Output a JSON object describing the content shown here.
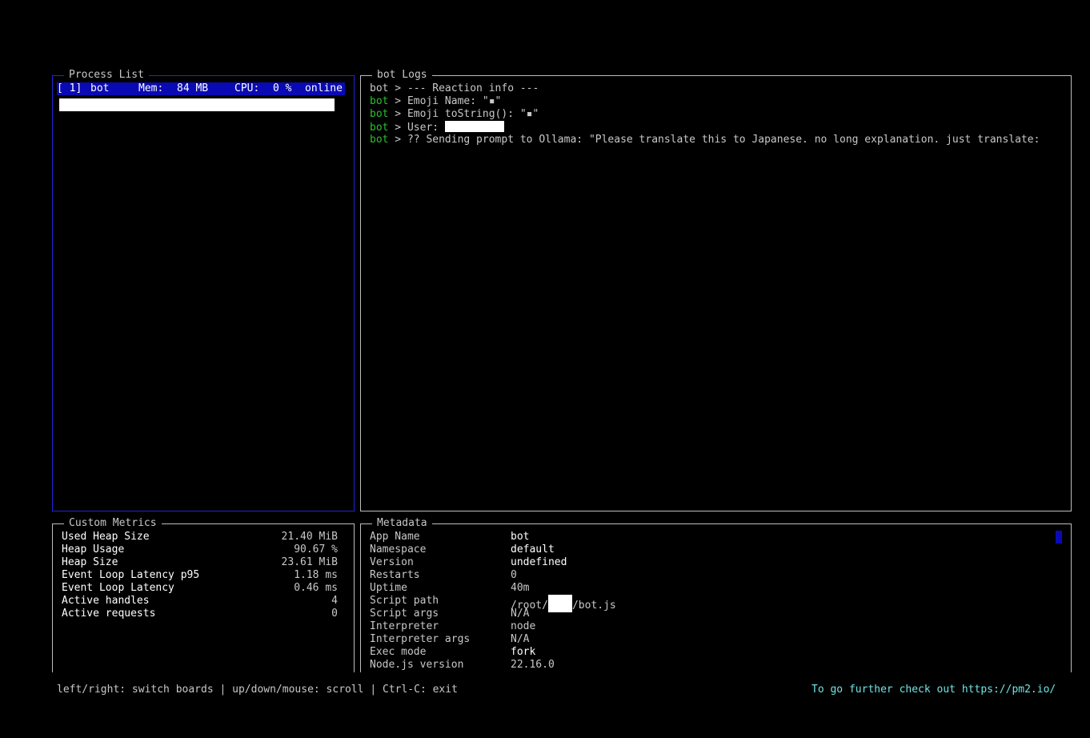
{
  "process_list": {
    "title": "Process List",
    "row": {
      "id": "[ 1]",
      "name": "bot",
      "mem_label": "Mem:",
      "mem_value": "84 MB",
      "cpu_label": "CPU:",
      "cpu_value": "0 %",
      "status": "online"
    }
  },
  "logs": {
    "title": "bot Logs",
    "lines": [
      {
        "source": "bot",
        "text": " > --- Reaction info ---"
      },
      {
        "source": "bot",
        "text": " > Emoji Name: \"▪\""
      },
      {
        "source": "bot",
        "text": " > Emoji toString(): \"▪\""
      },
      {
        "source": "bot",
        "text": " > User: "
      },
      {
        "source": "bot",
        "text": " > ?? Sending prompt to Ollama: \"Please translate this to Japanese. no long explanation. just translate:"
      }
    ]
  },
  "metrics": {
    "title": "Custom Metrics",
    "rows": [
      {
        "name": "Used Heap Size",
        "value": "21.40 MiB"
      },
      {
        "name": "Heap Usage",
        "value": "90.67 %"
      },
      {
        "name": "Heap Size",
        "value": "23.61 MiB"
      },
      {
        "name": "Event Loop Latency p95",
        "value": "1.18 ms"
      },
      {
        "name": "Event Loop Latency",
        "value": "0.46 ms"
      },
      {
        "name": "Active handles",
        "value": "4"
      },
      {
        "name": "Active requests",
        "value": "0"
      }
    ]
  },
  "metadata": {
    "title": "Metadata",
    "rows": [
      {
        "key": "App Name",
        "value": "bot"
      },
      {
        "key": "Namespace",
        "value": "default"
      },
      {
        "key": "Version",
        "value": "undefined"
      },
      {
        "key": "Restarts",
        "value": "0"
      },
      {
        "key": "Uptime",
        "value": "40m"
      },
      {
        "key": "Script path",
        "value_prefix": "/root/",
        "value_suffix": "/bot.js"
      },
      {
        "key": "Script args",
        "value": "N/A"
      },
      {
        "key": "Interpreter",
        "value": "node"
      },
      {
        "key": "Interpreter args",
        "value": "N/A"
      },
      {
        "key": "Exec mode",
        "value": "fork"
      },
      {
        "key": "Node.js version",
        "value": "22.16.0"
      }
    ]
  },
  "footer": {
    "help": "left/right: switch boards | up/down/mouse: scroll | Ctrl-C: exit",
    "promo": "To go further check out https://pm2.io/"
  },
  "colors": {
    "selection": "#0a0ab4",
    "focus_border": "#2323d6",
    "log_source_green": "#2bc02b",
    "promo": "#6fe3e3"
  }
}
